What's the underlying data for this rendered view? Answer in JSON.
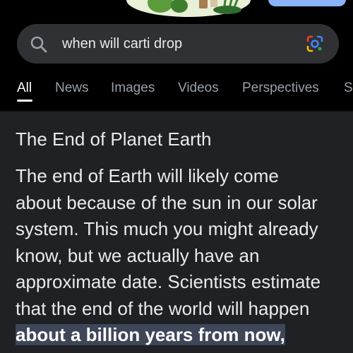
{
  "search": {
    "query": "when will carti drop"
  },
  "tabs": [
    {
      "label": "All",
      "active": true
    },
    {
      "label": "News",
      "active": false
    },
    {
      "label": "Images",
      "active": false
    },
    {
      "label": "Videos",
      "active": false
    },
    {
      "label": "Perspectives",
      "active": false
    },
    {
      "label": "S",
      "active": false
    }
  ],
  "result": {
    "title": "The End of Planet Earth",
    "body_lines": [
      "The end of Earth will likely come",
      "about because of the sun in our solar",
      "system. This much you might already",
      "know, but we actually have an",
      "approximate date. Scientists estimate",
      "that the end of the world will happen"
    ],
    "highlight": "about a billion years from now,"
  },
  "colors": {
    "background": "#202124",
    "header_background": "#000000",
    "search_bar": "#303134",
    "text": "#e8eaed",
    "muted_text": "#9aa0a6",
    "accent": "#8ab4f8",
    "highlight": "#3e4658"
  },
  "icons": {
    "search": "search-icon",
    "lens": "google-lens-icon",
    "doodle": "doodle-illustration-icon"
  }
}
